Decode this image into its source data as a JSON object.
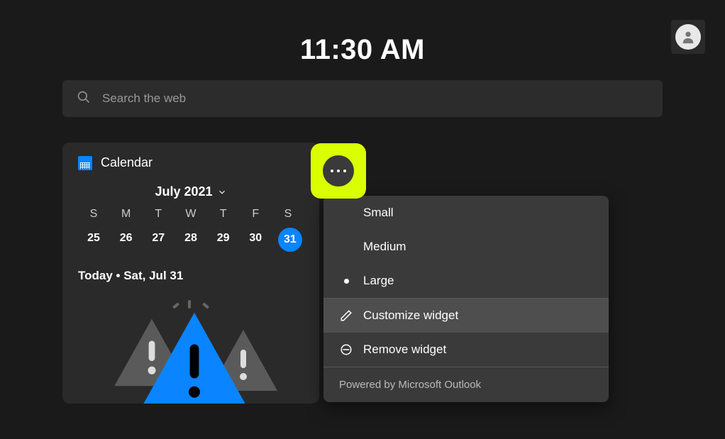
{
  "clock_time": "11:30 AM",
  "search": {
    "placeholder": "Search the web"
  },
  "calendar": {
    "title": "Calendar",
    "month_label": "July 2021",
    "dow": [
      "S",
      "M",
      "T",
      "W",
      "T",
      "F",
      "S"
    ],
    "dates": [
      "25",
      "26",
      "27",
      "28",
      "29",
      "30",
      "31"
    ],
    "selected_index": 6,
    "today_line": "Today • Sat, Jul 31"
  },
  "context_menu": {
    "size_options": [
      {
        "label": "Small",
        "selected": false
      },
      {
        "label": "Medium",
        "selected": false
      },
      {
        "label": "Large",
        "selected": true
      }
    ],
    "customize_label": "Customize widget",
    "remove_label": "Remove widget",
    "footer": "Powered by Microsoft Outlook"
  }
}
